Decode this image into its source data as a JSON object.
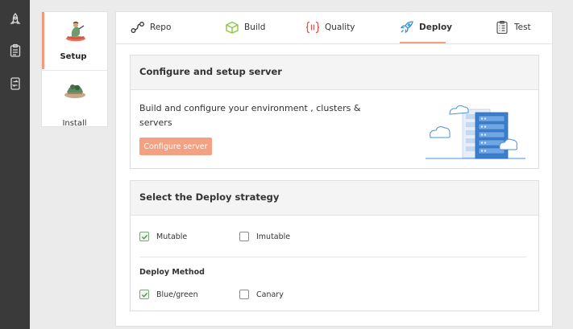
{
  "rail": {
    "icons": [
      "rocket-icon",
      "clipboard-list-icon",
      "swap-icon"
    ]
  },
  "sidebar": {
    "items": [
      {
        "label": "Setup",
        "icon": "setup-illustration",
        "active": true
      },
      {
        "label": "Install",
        "icon": "install-illustration",
        "active": false
      }
    ]
  },
  "tabs": [
    {
      "label": "Repo",
      "icon": "repo-icon"
    },
    {
      "label": "Build",
      "icon": "box-icon"
    },
    {
      "label": "Quality",
      "icon": "braces-icon"
    },
    {
      "label": "Deploy",
      "icon": "rocket-icon",
      "active": true
    },
    {
      "label": "Test",
      "icon": "checklist-icon"
    }
  ],
  "configure": {
    "title": "Configure and setup server",
    "description": "Build and configure your environment , clusters & servers",
    "button": "Configure server"
  },
  "strategy": {
    "title": "Select the Deploy strategy",
    "options": [
      {
        "label": "Mutable",
        "checked": true
      },
      {
        "label": "Imutable",
        "checked": false
      }
    ],
    "method_label": "Deploy Method",
    "methods": [
      {
        "label": "Blue/green",
        "checked": true
      },
      {
        "label": "Canary",
        "checked": false
      }
    ]
  },
  "colors": {
    "accent": "#f3a083",
    "rail": "#3a3a3a",
    "check": "#7aa77a",
    "build_icon": "#8cc63f",
    "quality_icon": "#e8554e",
    "deploy_icon": "#3a8fd9"
  }
}
